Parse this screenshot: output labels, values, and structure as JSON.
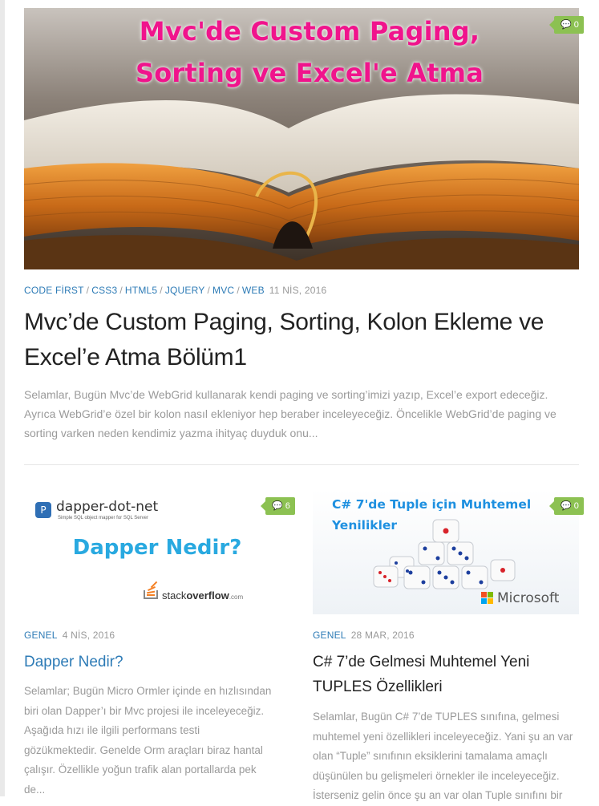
{
  "featured": {
    "image_title_line1": "Mvc'de Custom Paging,",
    "image_title_line2": "Sorting ve Excel'e Atma",
    "comments": "0",
    "categories": [
      "CODE FİRST",
      "CSS3",
      "HTML5",
      "JQUERY",
      "MVC",
      "WEB"
    ],
    "date": "11 NİS, 2016",
    "title": "Mvc’de Custom Paging, Sorting, Kolon Ekleme ve Excel’e Atma Bölüm1",
    "excerpt": "Selamlar, Bugün Mvc’de WebGrid kullanarak kendi paging ve sorting’imizi yazıp, Excel’e export edeceğiz. Ayrıca WebGrid’e özel bir kolon nasıl ekleniyor hep beraber inceleyeceğiz. Öncelikle WebGrid’de paging ve sorting varken neden kendimiz yazma ihityaç duyduk onu..."
  },
  "posts": [
    {
      "image": {
        "brand": "dapper-dot-net",
        "brand_sub": "Simple SQL object mapper for SQL Server",
        "headline": "Dapper Nedir?",
        "so_plain": "stack",
        "so_bold": "overflow",
        "so_suffix": ".com"
      },
      "comments": "6",
      "category": "GENEL",
      "date": "4 NİS, 2016",
      "title": "Dapper Nedir?",
      "excerpt": "Selamlar; Bugün Micro Ormler içinde en hızlısından biri olan Dapper’ı bir Mvc projesi ile inceleyeceğiz. Aşağıda hızı ile ilgili performans testi gözükmektedir. Genelde Orm araçları biraz hantal çalışır. Özellikle yoğun trafik alan portallarda pek de..."
    },
    {
      "image": {
        "headline_line1": "C# 7'de Tuple için Muhtemel",
        "headline_line2": "Yenilikler",
        "ms_label": "Microsoft"
      },
      "comments": "0",
      "category": "GENEL",
      "date": "28 MAR, 2016",
      "title": "C# 7’de Gelmesi Muhtemel Yeni TUPLES Özellikleri",
      "excerpt": "Selamlar, Bugün C# 7’de TUPLES sınıfına, gelmesi muhtemel yeni özellikleri inceleyeceğiz. Yani şu an var olan “Tuple” sınıfının eksiklerini tamalama amaçlı düşünülen bu gelişmeleri örnekler ile inceleyeceğiz. İsterseniz gelin önce şu an var olan Tuple sınıfını bir"
    }
  ],
  "colors": {
    "accent_link": "#2d7bb6",
    "badge": "#8cc152",
    "image_title": "#f0148c",
    "muted": "#9a9a9a"
  },
  "icons": {
    "comment": "comment-icon"
  }
}
